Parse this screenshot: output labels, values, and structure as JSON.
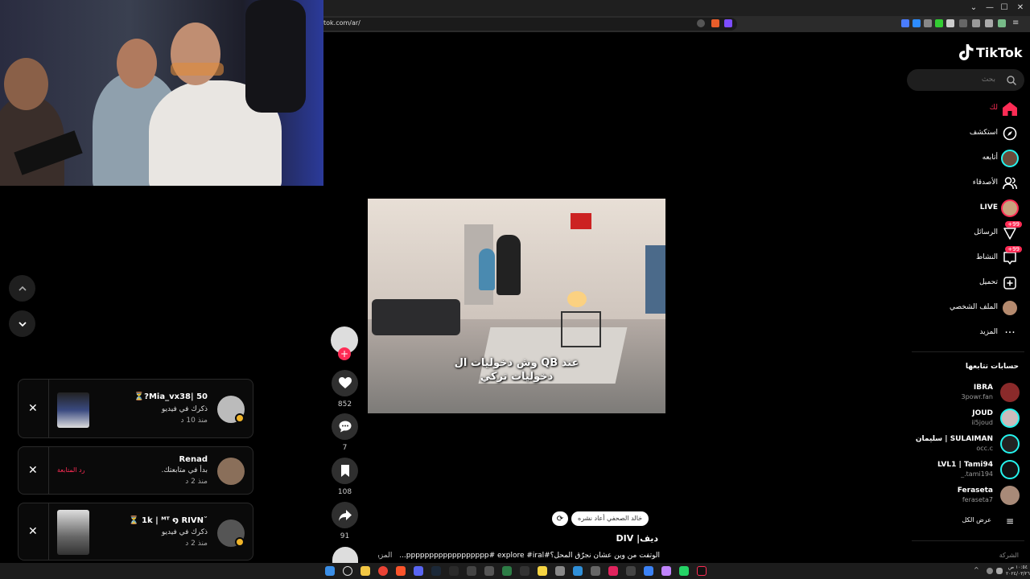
{
  "browser": {
    "url": "tok.com/ar/"
  },
  "colors": {
    "accent": "#fe2c55",
    "bg": "#000000",
    "panel": "#1e1e1e"
  },
  "sidebar": {
    "logo_text": "TikTok",
    "search_placeholder": "بحث",
    "nav": [
      {
        "label": "لك",
        "icon": "home-icon",
        "active": true
      },
      {
        "label": "استكشف",
        "icon": "compass-icon"
      },
      {
        "label": "أتابعه",
        "icon": "following-avatar-icon"
      },
      {
        "label": "الأصدقاء",
        "icon": "friends-icon"
      },
      {
        "label": "LIVE",
        "icon": "live-avatar-icon"
      },
      {
        "label": "الرسائل",
        "icon": "messages-icon",
        "badge": "+99"
      },
      {
        "label": "النشاط",
        "icon": "activity-icon",
        "badge": "+99"
      },
      {
        "label": "تحميل",
        "icon": "upload-icon"
      },
      {
        "label": "الملف الشخصي",
        "icon": "profile-avatar-icon"
      },
      {
        "label": "المزيد",
        "icon": "more-icon"
      }
    ],
    "following_title": "حسابات تتابعها",
    "following": [
      {
        "name": "IBRA",
        "handle": "3powr.fan"
      },
      {
        "name": "JOUD",
        "handle": "ii5joud"
      },
      {
        "name": "سليمان | SULAIMAN",
        "handle": "occ.c"
      },
      {
        "name": "LVL1 | Tami94",
        "handle": "_.tami194"
      },
      {
        "name": "Feraseta",
        "handle": "feraseta7"
      }
    ],
    "see_all": "عرض الكل",
    "company": "الشركة"
  },
  "video": {
    "overlay_line1": "وش دخوليات ال QB عند",
    "overlay_line2": "دخوليات تركي",
    "likes": "852",
    "comments": "7",
    "saves": "108",
    "shares": "91",
    "repost_text": "خالد الصحفي أعاد نشره",
    "author": "ديف| DIV",
    "caption": "الوتفت من وين عشان نجرّق المحل؟#pppppppppppppppppp# explore #iral...",
    "caption_more": "المزيد"
  },
  "notifications": [
    {
      "name": "Mia_vx38| 50?⏳",
      "message": "ذكرك في فيديو",
      "time": "منذ 10 د"
    },
    {
      "name": "Renad",
      "message": "بدأ في متابعتك.",
      "time": "منذ 2 د",
      "action": "رد المتابعة"
    },
    {
      "name": "˘1k | ᴹᵀ ໑ RIVN ⏳",
      "message": "ذكرك في فيديو",
      "time": "منذ 2 د"
    }
  ],
  "taskbar": {
    "time": "١٠:٥٤ ص",
    "date": "٢٠٢٤/٠٣/٢٦"
  }
}
